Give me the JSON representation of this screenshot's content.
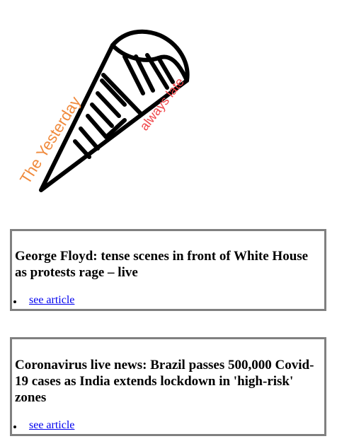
{
  "brand": {
    "name": "The Yesterday",
    "tagline": "always late",
    "name_color": "#f08a3c",
    "tagline_color": "#f0464a",
    "icon": "rolled-newspaper-icon"
  },
  "articles": [
    {
      "title": "George Floyd: tense scenes in front of White House as protests rage – live",
      "link_label": "see article"
    },
    {
      "title": "Coronavirus live news: Brazil passes 500,000 Covid-19 cases as India extends lockdown in 'high-risk' zones",
      "link_label": "see article"
    }
  ],
  "colors": {
    "card_border": "#808080",
    "link": "#0000ee"
  }
}
